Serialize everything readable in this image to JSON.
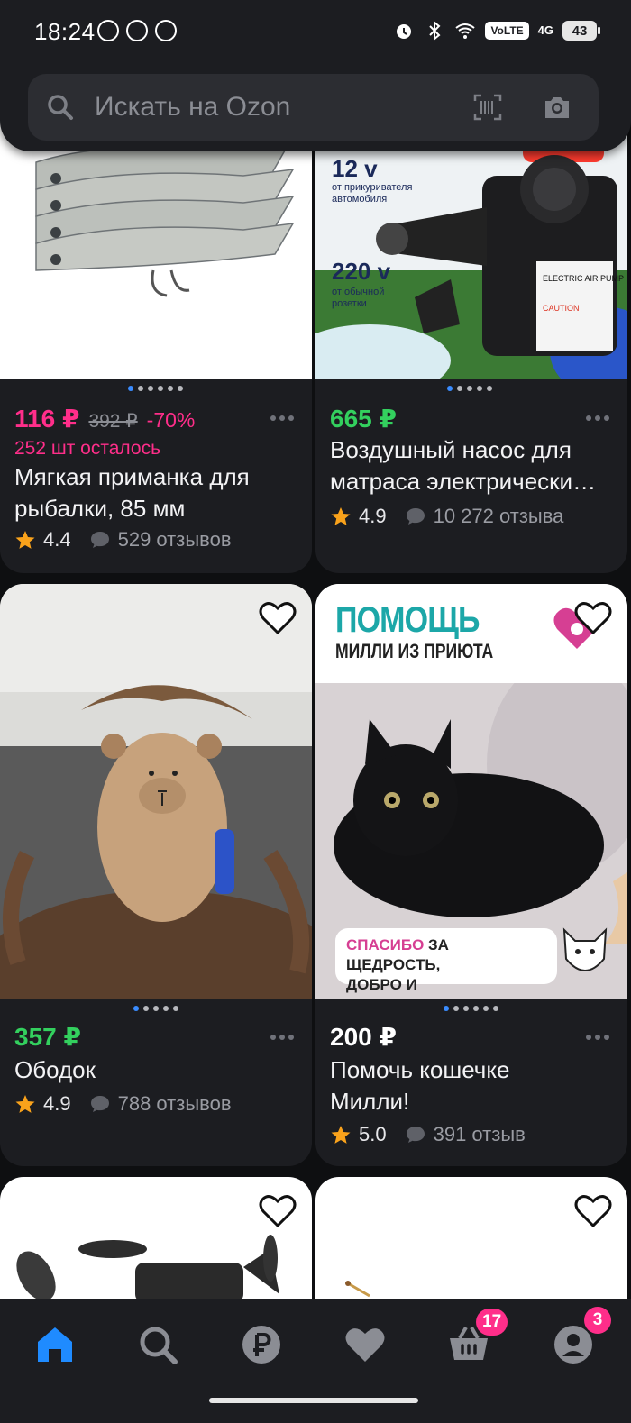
{
  "status_bar": {
    "time": "18:24",
    "volte": "VoLTE",
    "network": "4G",
    "battery": "43"
  },
  "search": {
    "placeholder": "Искать на Ozon"
  },
  "products": [
    {
      "price": "116 ₽",
      "old_price": "392 ₽",
      "discount": "-70%",
      "stock": "252 шт осталось",
      "title": "Мягкая приманка для рыбалки, 85 мм",
      "rating": "4.4",
      "reviews": "529 отзывов"
    },
    {
      "price": "665 ₽",
      "title": "Воздушный насос для матраса электрически…",
      "rating": "4.9",
      "reviews": "10 272 отзыва",
      "image_text": {
        "v12": "12 v",
        "v12_sub": "от прикуривателя автомобиля",
        "v220": "220 v",
        "v220_sub": "от обычной розетки"
      }
    },
    {
      "price": "357 ₽",
      "title": "Ободок",
      "rating": "4.9",
      "reviews": "788 отзывов"
    },
    {
      "price": "200 ₽",
      "title": "Помочь кошечке Милли!",
      "rating": "5.0",
      "reviews": "391 отзыв",
      "image_text": {
        "headline": "ПОМОЩЬ",
        "subline": "МИЛЛИ ИЗ ПРИЮТА",
        "thanks_accent": "СПАСИБО",
        "thanks_rest": " ЗА ЩЕДРОСТЬ,",
        "thanks_line2": "ДОБРО И НЕРАВНОДУШИЕ"
      }
    }
  ],
  "nav": {
    "cart_badge": "17",
    "profile_badge": "3"
  },
  "colors": {
    "accent_pink": "#ff2e8a",
    "price_green": "#33d05e",
    "nav_active": "#1f8bff",
    "star": "#f9a21b"
  }
}
